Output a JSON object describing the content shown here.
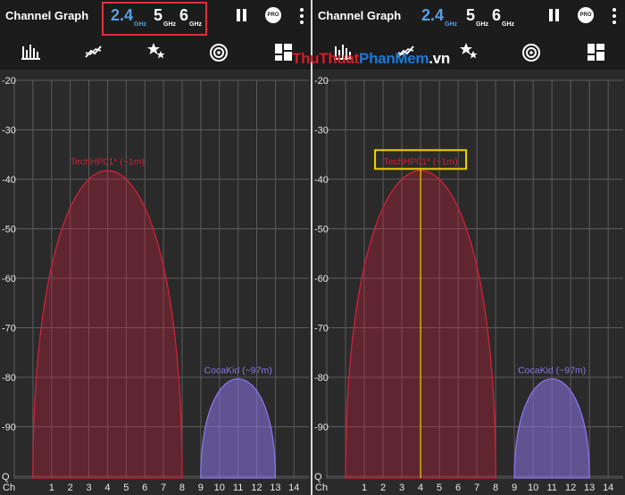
{
  "app": {
    "title": "Channel Graph"
  },
  "bands": [
    {
      "value": "2.4",
      "unit": "GHz",
      "active": true
    },
    {
      "value": "5",
      "unit": "GHz",
      "active": false
    },
    {
      "value": "6",
      "unit": "GHz",
      "active": false
    }
  ],
  "toolbar": {
    "pro_label": "PRO"
  },
  "tabs": [
    {
      "name": "channel-graph",
      "icon": "bar-graph-icon",
      "selected": true
    },
    {
      "name": "time-graph",
      "icon": "line-chart-icon",
      "selected": false
    },
    {
      "name": "channel-rating",
      "icon": "stars-icon",
      "selected": false
    },
    {
      "name": "access-points",
      "icon": "wifi-signal-icon",
      "selected": false
    },
    {
      "name": "more",
      "icon": "grid-icon",
      "selected": false
    }
  ],
  "watermark": {
    "part1": "Thu",
    "part2": "Thuat",
    "part3": "PhanMem",
    "part4": ".vn"
  },
  "colors": {
    "accent": "#5a9fe0",
    "indicator": "#f2d200",
    "highlight_box": "#e0303a"
  },
  "chart_data": {
    "type": "area",
    "xlabel": "Ch",
    "x_ticks": [
      1,
      2,
      3,
      4,
      5,
      6,
      7,
      8,
      9,
      10,
      11,
      12,
      13,
      14
    ],
    "y_ticks": [
      "-20",
      "-30",
      "-40",
      "-50",
      "-60",
      "-70",
      "-80",
      "-90",
      "Q"
    ],
    "ylim": [
      -100,
      -20
    ],
    "grid": true,
    "series": [
      {
        "name": "TechHP01* (~1m)",
        "channel": 4,
        "from_channel": 0,
        "to_channel": 8,
        "peak": -38,
        "color": "#d0203a"
      },
      {
        "name": "CocaKid (~97m)",
        "channel": 11,
        "from_channel": 9,
        "to_channel": 13,
        "peak": -80,
        "color": "#8b75e8"
      }
    ]
  }
}
